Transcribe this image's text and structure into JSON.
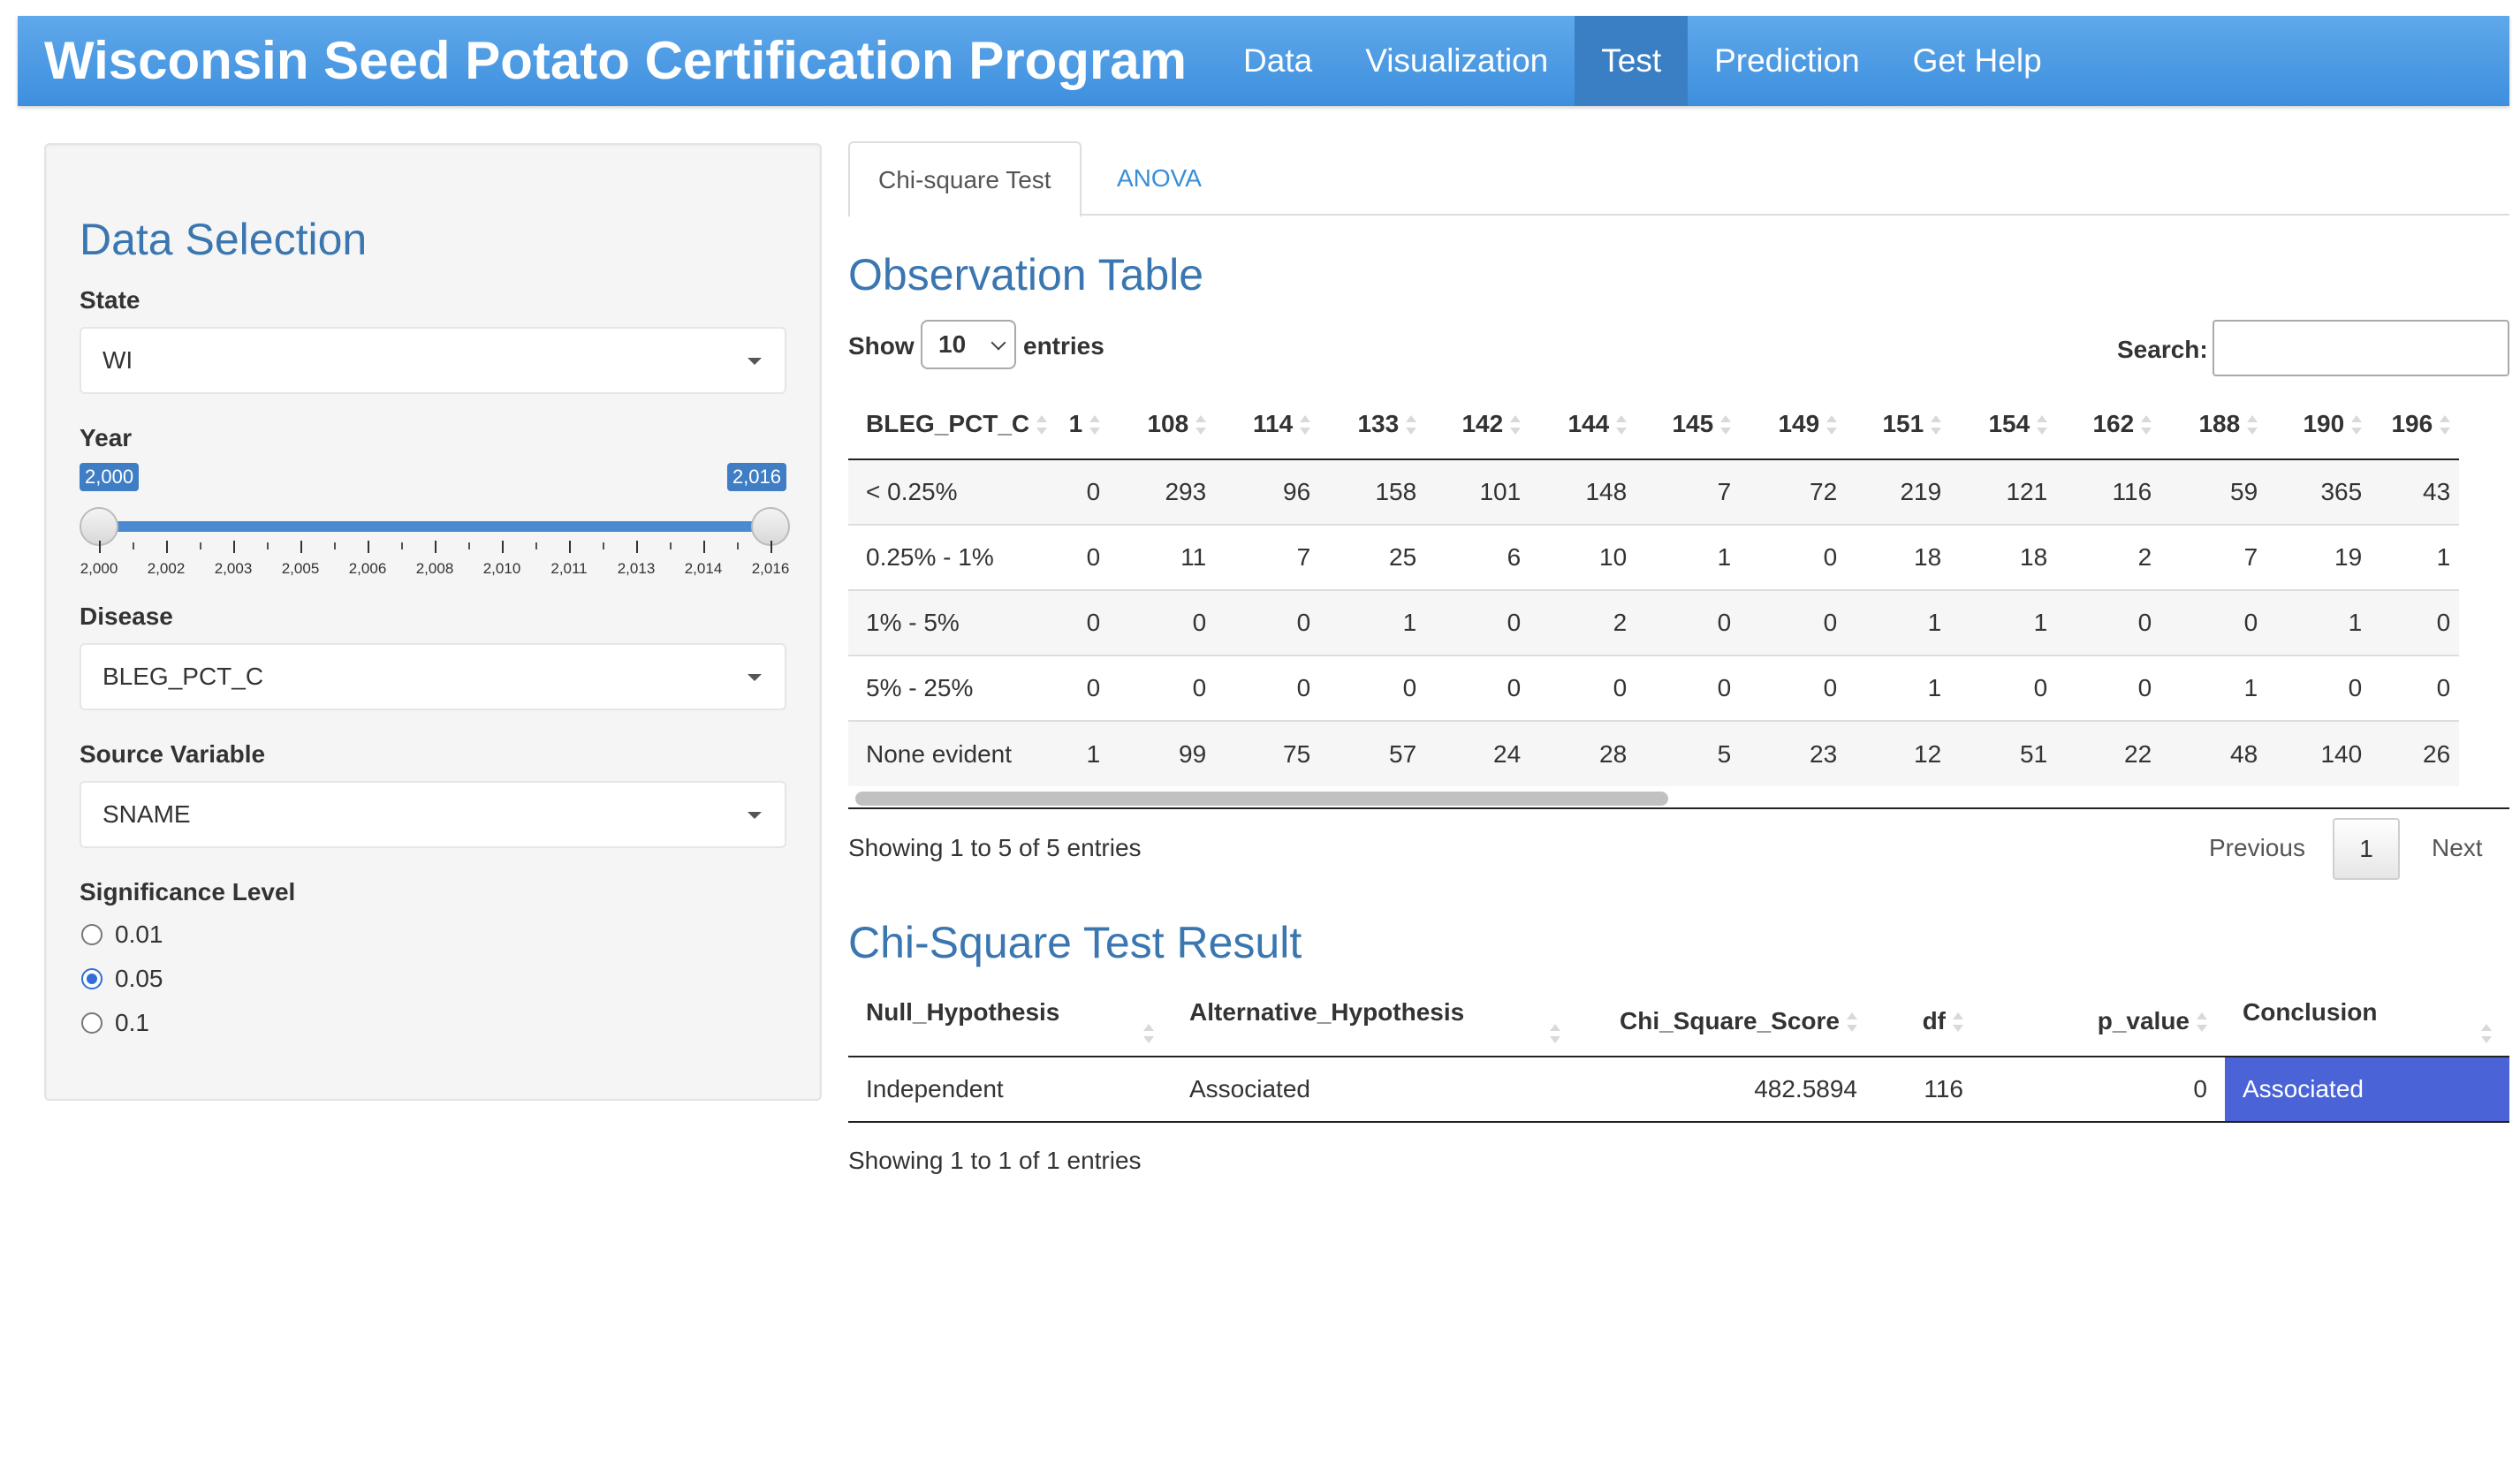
{
  "navbar": {
    "brand": "Wisconsin Seed Potato Certification Program",
    "items": [
      "Data",
      "Visualization",
      "Test",
      "Prediction",
      "Get Help"
    ],
    "active": "Test"
  },
  "sidebar": {
    "title": "Data Selection",
    "state": {
      "label": "State",
      "value": "WI"
    },
    "year": {
      "label": "Year",
      "min_label": "2,000",
      "max_label": "2,016",
      "range": [
        2000,
        2016
      ],
      "selected": [
        2000,
        2016
      ],
      "tick_labels": [
        "2,000",
        "2,002",
        "2,003",
        "2,005",
        "2,006",
        "2,008",
        "2,010",
        "2,011",
        "2,013",
        "2,014",
        "2,016"
      ]
    },
    "disease": {
      "label": "Disease",
      "value": "BLEG_PCT_C"
    },
    "source": {
      "label": "Source Variable",
      "value": "SNAME"
    },
    "significance": {
      "label": "Significance Level",
      "options": [
        "0.01",
        "0.05",
        "0.1"
      ],
      "selected": "0.05"
    }
  },
  "tabs": [
    "Chi-square Test",
    "ANOVA"
  ],
  "observation": {
    "title": "Observation Table",
    "show_label": "Show",
    "entries_label": "entries",
    "page_length": "10",
    "search_label": "Search:",
    "columns": [
      "BLEG_PCT_C",
      "1",
      "108",
      "114",
      "133",
      "142",
      "144",
      "145",
      "149",
      "151",
      "154",
      "162",
      "188",
      "190",
      "196"
    ],
    "rows": [
      [
        "< 0.25%",
        "0",
        "293",
        "96",
        "158",
        "101",
        "148",
        "7",
        "72",
        "219",
        "121",
        "116",
        "59",
        "365",
        "43"
      ],
      [
        "0.25% - 1%",
        "0",
        "11",
        "7",
        "25",
        "6",
        "10",
        "1",
        "0",
        "18",
        "18",
        "2",
        "7",
        "19",
        "1"
      ],
      [
        "1% - 5%",
        "0",
        "0",
        "0",
        "1",
        "0",
        "2",
        "0",
        "0",
        "1",
        "1",
        "0",
        "0",
        "1",
        "0"
      ],
      [
        "5% - 25%",
        "0",
        "0",
        "0",
        "0",
        "0",
        "0",
        "0",
        "0",
        "1",
        "0",
        "0",
        "1",
        "0",
        "0"
      ],
      [
        "None evident",
        "1",
        "99",
        "75",
        "57",
        "24",
        "28",
        "5",
        "23",
        "12",
        "51",
        "22",
        "48",
        "140",
        "26"
      ]
    ],
    "info": "Showing 1 to 5 of 5 entries",
    "prev": "Previous",
    "page": "1",
    "next": "Next"
  },
  "result": {
    "title": "Chi-Square Test Result",
    "columns": [
      "Null_Hypothesis",
      "Alternative_Hypothesis",
      "Chi_Square_Score",
      "df",
      "p_value",
      "Conclusion"
    ],
    "row": [
      "Independent",
      "Associated",
      "482.5894",
      "116",
      "0",
      "Associated"
    ],
    "info": "Showing 1 to 1 of 1 entries"
  },
  "colors": {
    "navbar": "#3d8fde",
    "accent": "#3a76b0",
    "conclusion": "#4a64d8"
  }
}
